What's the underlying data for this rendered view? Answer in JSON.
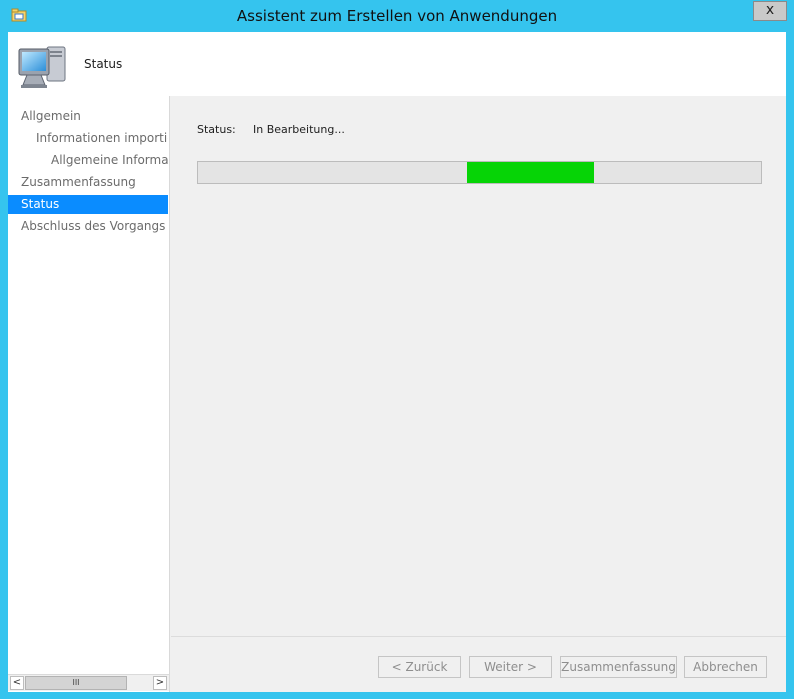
{
  "window": {
    "title": "Assistent zum Erstellen von Anwendungen",
    "close_label": "x",
    "frame_color": "#35c4ee"
  },
  "header": {
    "icon": "computer-icon",
    "title": "Status"
  },
  "nav": {
    "items": [
      {
        "label": "Allgemein",
        "level": 0,
        "selected": false
      },
      {
        "label": "Informationen importieren",
        "level": 1,
        "selected": false
      },
      {
        "label": "Allgemeine Informationen",
        "level": 2,
        "selected": false
      },
      {
        "label": "Zusammenfassung",
        "level": 0,
        "selected": false
      },
      {
        "label": "Status",
        "level": 0,
        "selected": true
      },
      {
        "label": "Abschluss des Vorgangs",
        "level": 0,
        "selected": false
      }
    ],
    "selected_color": "#0a8cff",
    "scrollbar": {
      "left_arrow": "<",
      "right_arrow": ">",
      "thumb_grip": "III"
    }
  },
  "main": {
    "status_label": "Status:",
    "status_value": "In Bearbeitung...",
    "progress": {
      "start_fraction": 0.478,
      "fill_fraction": 0.225,
      "color": "#06d406"
    }
  },
  "footer": {
    "back_label": "< Zurück",
    "next_label": "Weiter >",
    "summary_label": "Zusammenfassung",
    "cancel_label": "Abbrechen"
  }
}
